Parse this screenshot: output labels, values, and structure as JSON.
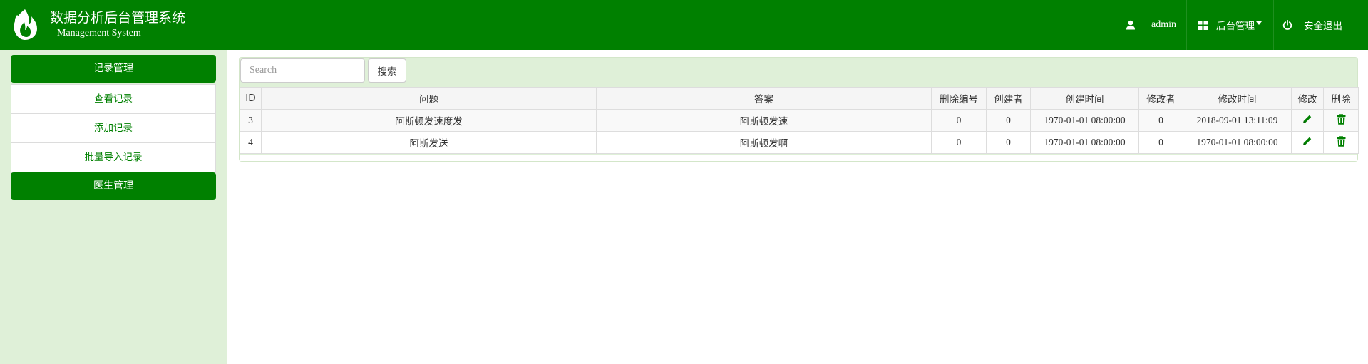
{
  "header": {
    "title": "数据分析后台管理系统",
    "subtitle": "Management System",
    "user": "admin",
    "admin_menu": "后台管理",
    "logout": "安全退出"
  },
  "sidebar": {
    "groups": [
      {
        "label": "记录管理",
        "items": [
          "查看记录",
          "添加记录",
          "批量导入记录"
        ]
      },
      {
        "label": "医生管理"
      }
    ]
  },
  "search": {
    "placeholder": "Search",
    "button": "搜索"
  },
  "table": {
    "columns": [
      "ID",
      "问题",
      "答案",
      "删除编号",
      "创建者",
      "创建时间",
      "修改者",
      "修改时间",
      "修改",
      "删除"
    ],
    "rows": [
      {
        "id": "3",
        "question": "阿斯顿发速度发",
        "answer": "阿斯顿发速",
        "del_no": "0",
        "creator": "0",
        "created": "1970-01-01 08:00:00",
        "modifier": "0",
        "modified": "2018-09-01 13:11:09"
      },
      {
        "id": "4",
        "question": "阿斯发送",
        "answer": "阿斯顿发啊",
        "del_no": "0",
        "creator": "0",
        "created": "1970-01-01 08:00:00",
        "modifier": "0",
        "modified": "1970-01-01 08:00:00"
      }
    ]
  },
  "icons": {
    "edit": "pencil-icon",
    "delete": "trash-icon",
    "user": "user-icon",
    "grid": "th-large-icon",
    "power": "power-icon",
    "logo": "flame-logo-icon"
  },
  "colors": {
    "primary": "#008000",
    "sidebar_bg": "#dff0d8",
    "link": "#008000"
  }
}
